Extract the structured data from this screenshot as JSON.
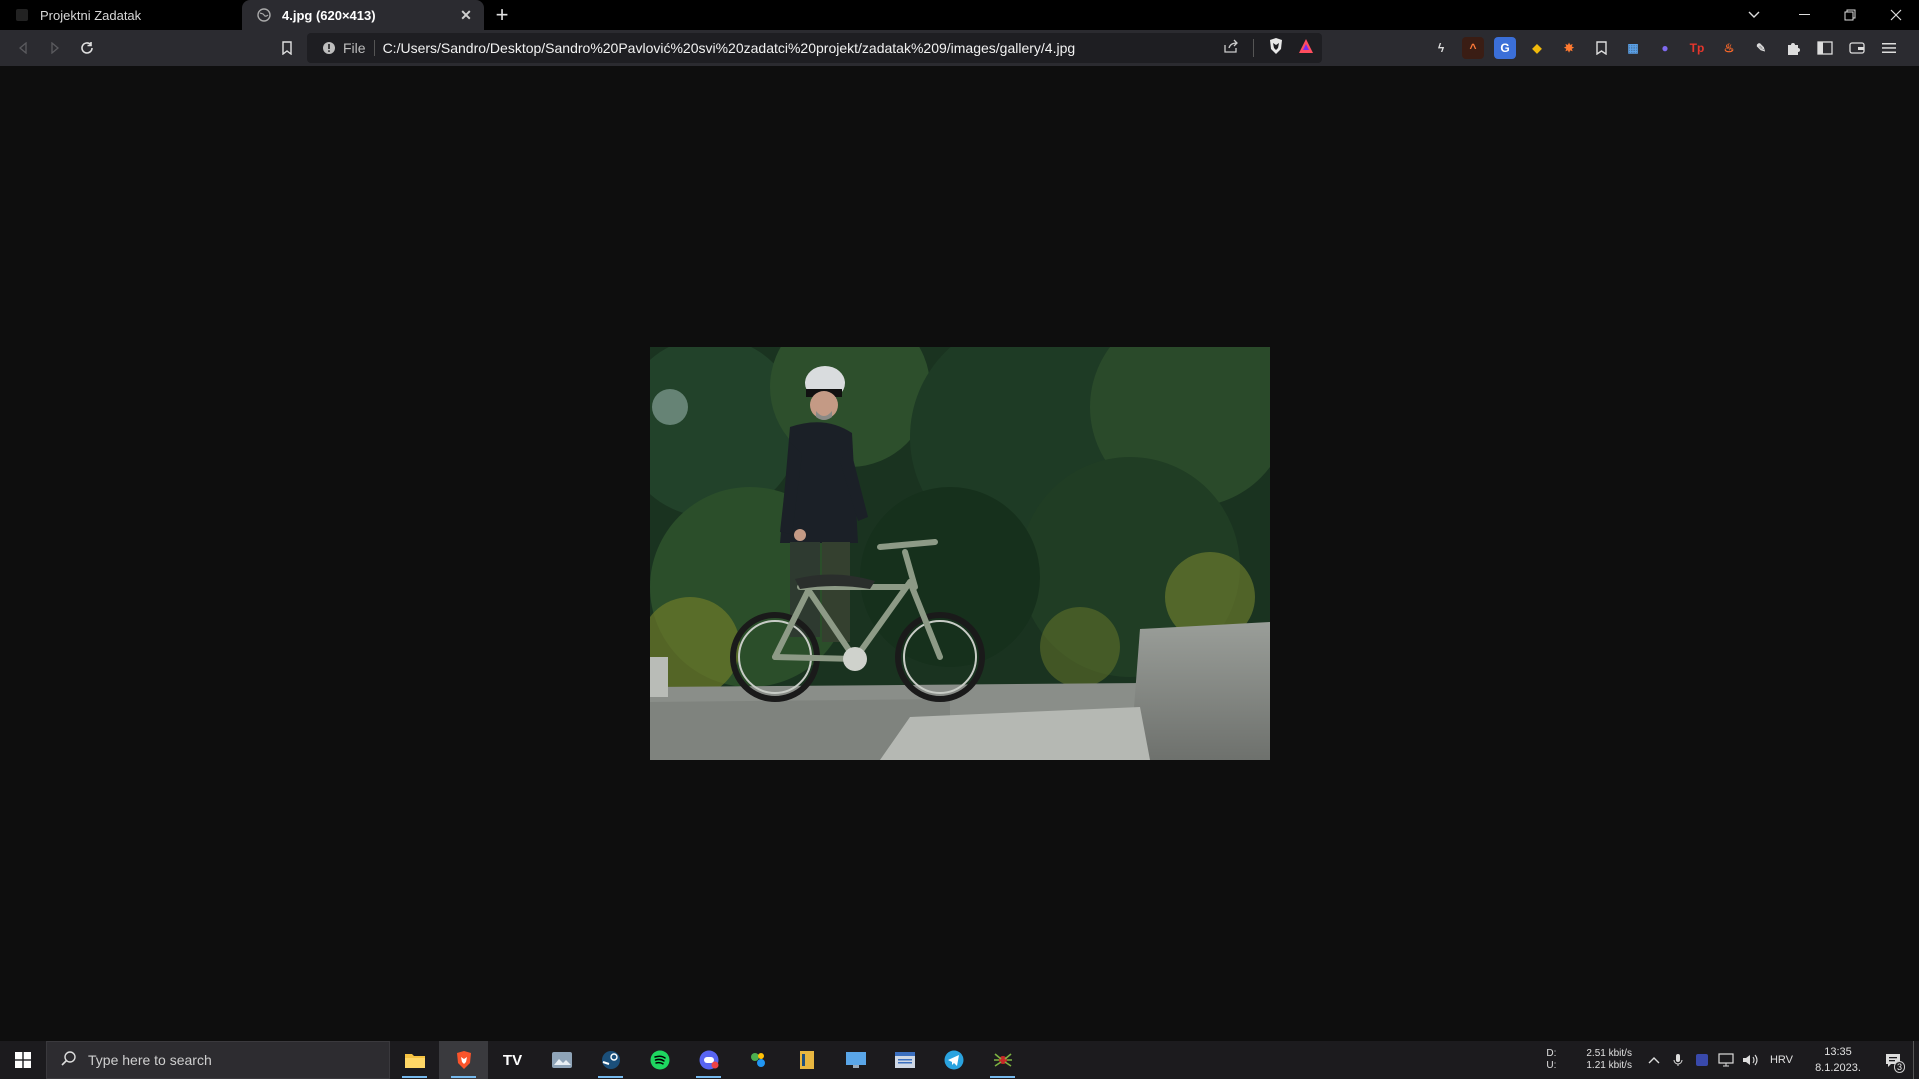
{
  "browser": {
    "tabs": [
      {
        "title": "Projektni Zadatak",
        "active": false
      },
      {
        "title": "4.jpg (620×413)",
        "active": true
      }
    ],
    "address_bar": {
      "scheme_label": "File",
      "url": "C:/Users/Sandro/Desktop/Sandro%20Pavlović%20svi%20zadatci%20projekt/zadatak%209/images/gallery/4.jpg"
    },
    "extensions": [
      "lightning-ext-icon",
      "readwise-ext-icon",
      "translate-ext-icon",
      "binance-ext-icon",
      "spark-ext-icon",
      "bookmark-ext-icon",
      "grid-ext-icon",
      "ghost-ext-icon",
      "tp-ext-icon",
      "fire-ext-icon",
      "pen-ext-icon",
      "extensions-icon",
      "sidebar-icon",
      "wallet-icon",
      "menu-icon"
    ],
    "colors": {
      "tab_bg": "#000000",
      "toolbar_bg": "#2b2b30",
      "page_bg": "#0e0e0e",
      "brave_orange": "#fb542b"
    }
  },
  "image": {
    "description_name": "bmx-rider-photo"
  },
  "taskbar": {
    "search_placeholder": "Type here to search",
    "apps": [
      "file-explorer",
      "brave",
      "tradingview",
      "photos",
      "steam",
      "spotify",
      "discord",
      "network-app",
      "book-app",
      "remote-desktop",
      "word-like-app",
      "telegram",
      "spider-app"
    ],
    "net_labels": {
      "down": "D:",
      "up": "U:"
    },
    "net_values": {
      "down": "2.51 kbit/s",
      "up": "1.21 kbit/s"
    },
    "language": "HRV",
    "time": "13:35",
    "date": "8.1.2023.",
    "notification_count": "3"
  }
}
